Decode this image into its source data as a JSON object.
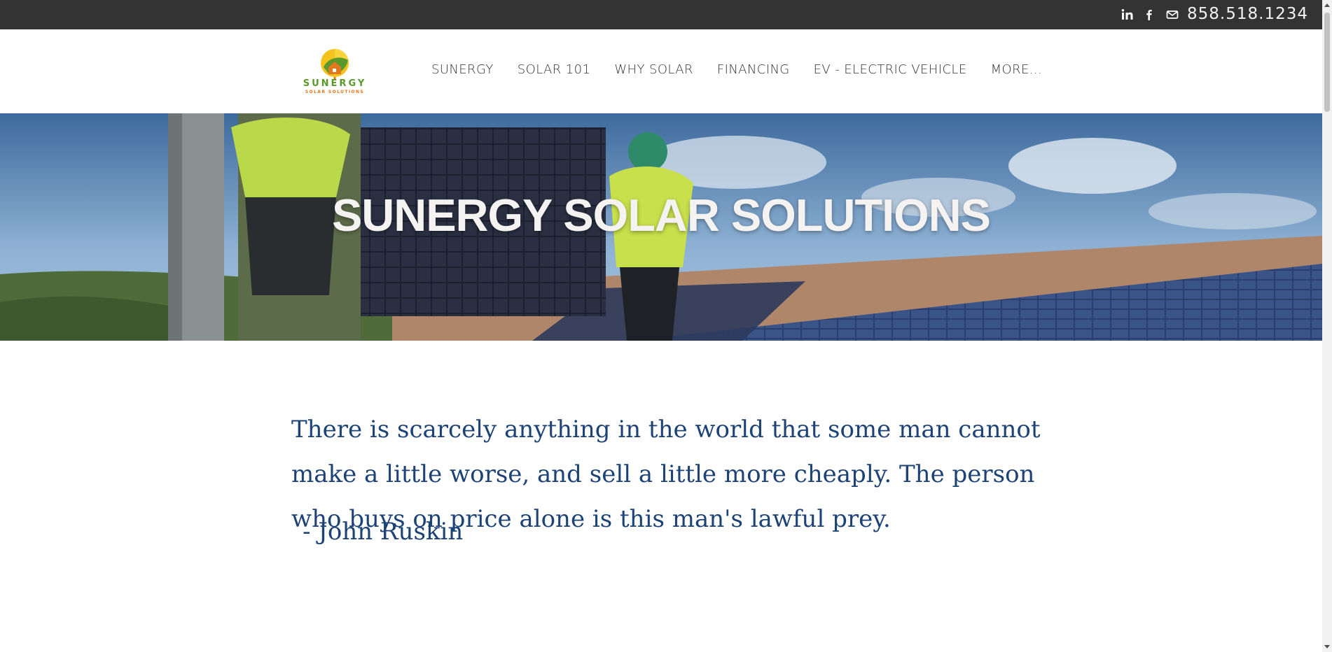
{
  "topbar": {
    "social": [
      {
        "icon": "linkedin-icon",
        "glyph": "in"
      },
      {
        "icon": "facebook-icon",
        "glyph": "f"
      },
      {
        "icon": "email-icon",
        "glyph": "✉"
      }
    ],
    "phone": "858.518.1234"
  },
  "logo": {
    "name": "SUNERGY",
    "tagline": "SOLAR SOLUTIONS"
  },
  "nav": {
    "items": [
      "SUNERGY",
      "SOLAR 101",
      "WHY SOLAR",
      "FINANCING",
      "EV - ELECTRIC VEHICLE",
      "MORE..."
    ]
  },
  "hero": {
    "title": "SUNERGY SOLAR SOLUTIONS"
  },
  "quote": {
    "text": "There is scarcely anything in the world that some man cannot make a little worse, and sell a little more cheaply. The person who buys on price alone is this man's lawful prey.",
    "author": "- John Ruskin"
  },
  "colors": {
    "topbar": "#333333",
    "quote": "#1d4275",
    "logo_green": "#5a9a2a",
    "logo_orange": "#e0781e"
  }
}
